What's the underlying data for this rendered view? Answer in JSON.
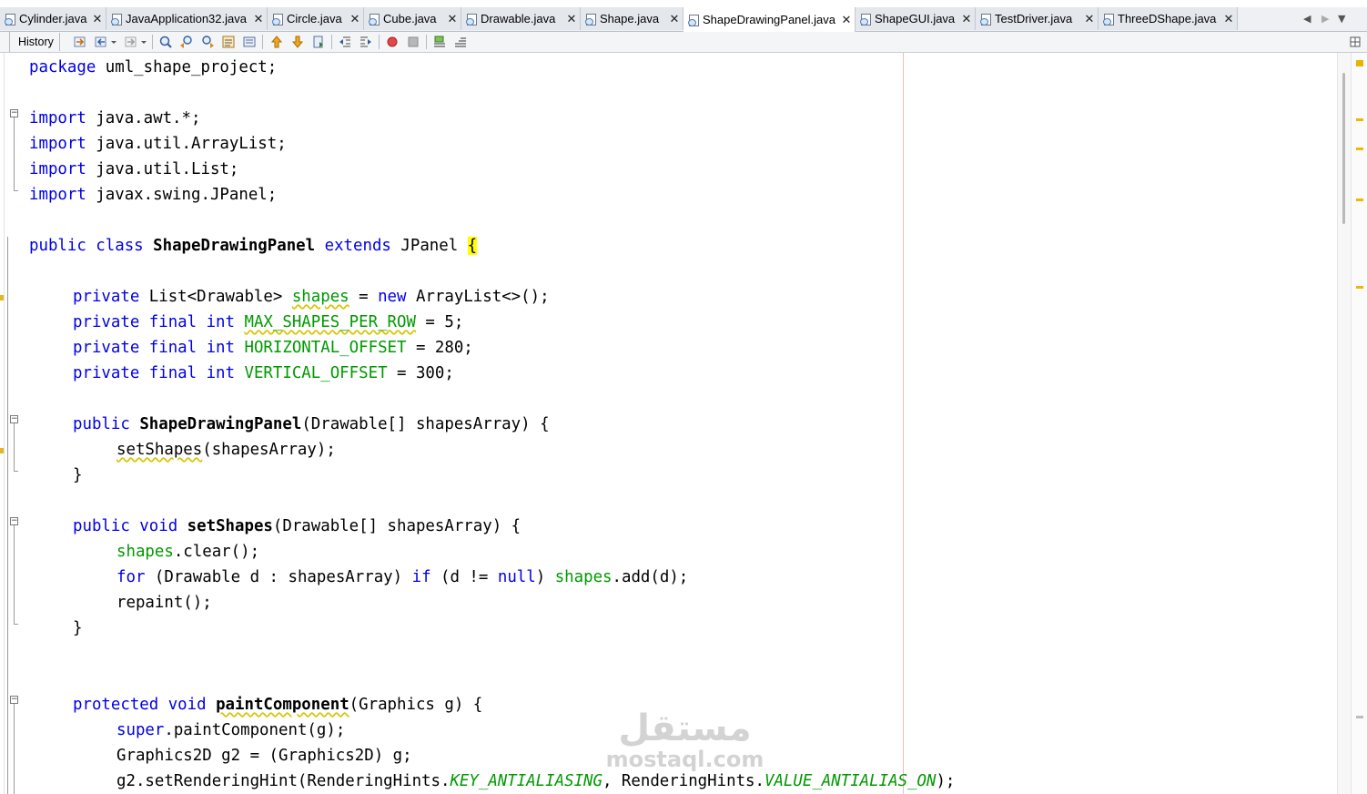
{
  "tabs": [
    {
      "label": "Cylinder.java",
      "active": false
    },
    {
      "label": "JavaApplication32.java",
      "active": false
    },
    {
      "label": "Circle.java",
      "active": false
    },
    {
      "label": "Cube.java",
      "active": false
    },
    {
      "label": "Drawable.java",
      "active": false
    },
    {
      "label": "Shape.java",
      "active": false
    },
    {
      "label": "ShapeDrawingPanel.java",
      "active": true
    },
    {
      "label": "ShapeGUI.java",
      "active": false
    },
    {
      "label": "TestDriver.java",
      "active": false
    },
    {
      "label": "ThreeDShape.java",
      "active": false
    }
  ],
  "tab_close_glyph": "✕",
  "tab_nav": {
    "prev": "◀",
    "next": "▶",
    "menu": "▼"
  },
  "toolbar": {
    "history_label": "History",
    "icons": [
      "last-edit-icon",
      "back-icon",
      "forward-icon",
      "find-selection-icon",
      "find-previous-icon",
      "find-next-icon",
      "toggle-highlight-icon",
      "previous-bookmark-icon",
      "next-bookmark-icon",
      "toggle-bookmark-icon",
      "shift-left-icon",
      "shift-right-icon",
      "start-macro-icon",
      "stop-macro-icon",
      "comment-icon",
      "uncomment-icon",
      "split-window-icon"
    ]
  },
  "code": {
    "line1": {
      "kw": "package",
      "rest": " uml_shape_project;"
    },
    "line3": {
      "kw": "import",
      "rest": " java.awt.*;"
    },
    "line4": {
      "kw": "import",
      "rest": " java.util.ArrayList;"
    },
    "line5": {
      "kw": "import",
      "rest": " java.util.List;"
    },
    "line6": {
      "kw": "import",
      "rest": " javax.swing.JPanel;"
    },
    "line8": {
      "kw1": "public class",
      "name": "ShapeDrawingPanel",
      "kw2": "extends",
      "rest": " JPanel ",
      "brace": "{"
    },
    "line10": {
      "kw": "private",
      "type": " List<Drawable> ",
      "field": "shapes",
      "eq": " = ",
      "kw2": "new",
      "rest": " ArrayList<>();"
    },
    "line11": {
      "kw": "private final int",
      "field": "MAX_SHAPES_PER_ROW",
      "rest": " = 5;"
    },
    "line12": {
      "kw": "private final int",
      "field": "HORIZONTAL_OFFSET",
      "rest": " = 280;"
    },
    "line13": {
      "kw": "private final int",
      "field": "VERTICAL_OFFSET",
      "rest": " = 300;"
    },
    "line15": {
      "kw": "public",
      "name": "ShapeDrawingPanel",
      "rest": "(Drawable[] shapesArray) {"
    },
    "line16": {
      "call": "setShapes",
      "rest": "(shapesArray);"
    },
    "line17": {
      "text": "}"
    },
    "line19": {
      "kw": "public void",
      "name": "setShapes",
      "rest": "(Drawable[] shapesArray) {"
    },
    "line20": {
      "field": "shapes",
      "rest": ".clear();"
    },
    "line21": {
      "kw": "for",
      "a": " (Drawable d : shapesArray) ",
      "kw2": "if",
      "b": " (d != ",
      "kw3": "null",
      "c": ") ",
      "field": "shapes",
      "rest": ".add(d);"
    },
    "line22": {
      "text": "repaint();"
    },
    "line23": {
      "text": "}"
    },
    "line26": {
      "kw": "protected void",
      "name": "paintComponent",
      "rest": "(Graphics g) {"
    },
    "line27": {
      "kw": "super",
      "rest": ".paintComponent(g);"
    },
    "line28": {
      "text": "Graphics2D g2 = (Graphics2D) g;"
    },
    "line29": {
      "a": "g2.setRenderingHint(RenderingHints.",
      "it1": "KEY_ANTIALIASING",
      "b": ", RenderingHints.",
      "it2": "VALUE_ANTIALIAS_ON",
      "c": ");"
    }
  },
  "watermark": {
    "arabic": "مستقل",
    "latin": "mostaql.com"
  },
  "colors": {
    "keyword": "#0000e6",
    "field": "#009900",
    "brace_highlight": "#ffff00",
    "warning": "#f2b705"
  }
}
